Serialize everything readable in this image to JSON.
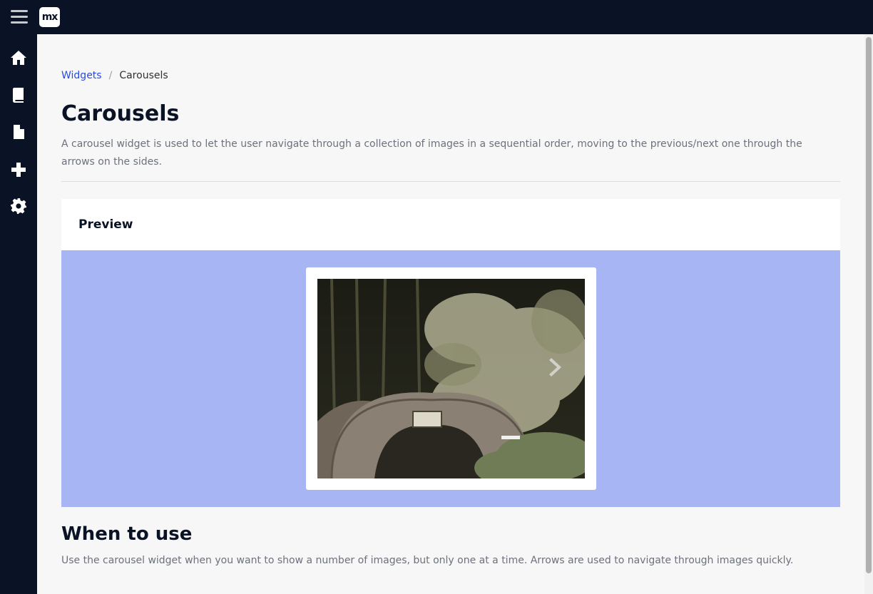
{
  "header": {
    "logo_text": "mx",
    "menu_icon": "hamburger-menu-icon"
  },
  "sidebar": {
    "items": [
      {
        "name": "home",
        "icon": "home-icon"
      },
      {
        "name": "book",
        "icon": "book-icon"
      },
      {
        "name": "document",
        "icon": "document-icon"
      },
      {
        "name": "add",
        "icon": "plus-icon"
      },
      {
        "name": "settings",
        "icon": "gear-icon"
      }
    ]
  },
  "breadcrumb": {
    "parent": "Widgets",
    "separator": "/",
    "current": "Carousels"
  },
  "page": {
    "title": "Carousels",
    "description": "A carousel widget is used to let the user navigate through a collection of images in a sequential order, moving to the previous/next one through the arrows on the sides."
  },
  "preview": {
    "title": "Preview",
    "image_icon": "carousel-image",
    "next_icon": "chevron-right-icon"
  },
  "usage": {
    "title": "When to use",
    "description": "Use the carousel widget when you want to show a number of images, but only one at a time. Arrows are used to navigate through images quickly."
  },
  "colors": {
    "nav_background": "#0a1325",
    "content_background": "#f7f7f7",
    "link": "#264ae5",
    "preview_background": "#a8b5f5"
  }
}
